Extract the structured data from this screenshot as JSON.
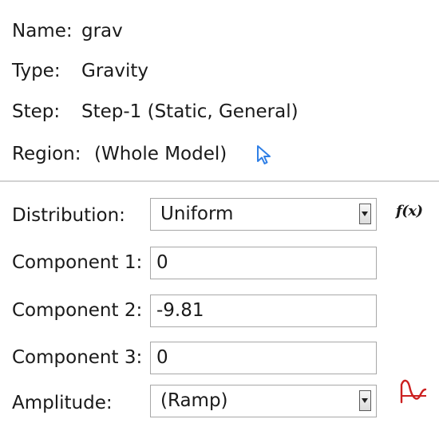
{
  "info": {
    "name_label": "Name:",
    "name_value": "grav",
    "type_label": "Type:",
    "type_value": "Gravity",
    "step_label": "Step:",
    "step_value": "Step-1 (Static, General)",
    "region_label": "Region:",
    "region_value": "(Whole Model)",
    "region_icon": "pointer-select-icon"
  },
  "form": {
    "distribution_label": "Distribution:",
    "distribution_value": "Uniform",
    "fx_label": "f(x)",
    "component1_label": "Component 1:",
    "component1_value": "0",
    "component2_label": "Component 2:",
    "component2_value": "-9.81",
    "component3_label": "Component 3:",
    "component3_value": "0",
    "amplitude_label": "Amplitude:",
    "amplitude_value": "(Ramp)",
    "amplitude_icon": "create-amplitude-icon"
  },
  "colors": {
    "cursor_icon": "#2f7fe6",
    "amplitude_icon": "#cc2020",
    "field_border": "#a8a8a8",
    "divider": "#d2d2d2"
  }
}
